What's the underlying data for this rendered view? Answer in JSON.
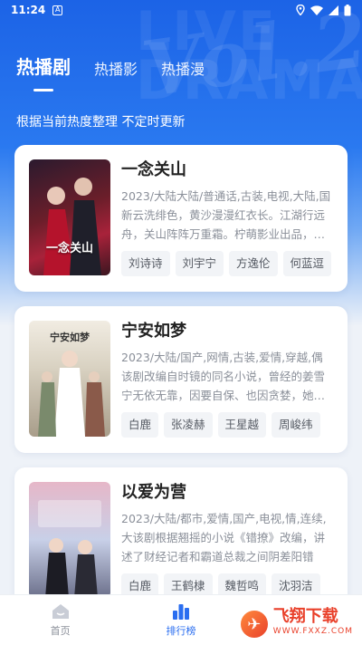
{
  "status_bar": {
    "time": "11:24",
    "notification_icon": "A"
  },
  "tabs": [
    {
      "label": "热播剧",
      "active": true
    },
    {
      "label": "热播影",
      "active": false
    },
    {
      "label": "热播漫",
      "active": false
    }
  ],
  "subtitle": "根据当前热度整理 不定时更新",
  "dramas": [
    {
      "title": "一念关山",
      "desc": "2023/大陆大陆/普通话,古装,电视,大陆,国新云洗绯色，黄沙漫漫红衣长。江湖行远舟，关山阵阵万重霜。柠萌影业出品，…",
      "actors": [
        "刘诗诗",
        "刘宇宁",
        "方逸伦",
        "何蓝逗"
      ],
      "poster_text": "一念关山"
    },
    {
      "title": "宁安如梦",
      "desc": "2023/大陆/国产,网情,古装,爱情,穿越,偶该剧改编自时镜的同名小说，曾经的姜雪宁无依无靠，因要自保、也因贪婪，她…",
      "actors": [
        "白鹿",
        "张凌赫",
        "王星越",
        "周峻纬"
      ],
      "poster_text": "宁安如梦"
    },
    {
      "title": "以爱为营",
      "desc": "2023/大陆/都市,爱情,国产,电视,情,连续,大该剧根据翘摇的小说《错撩》改编，讲述了财经记者和霸道总裁之间阴差阳错的…",
      "actors": [
        "白鹿",
        "王鹤棣",
        "魏哲鸣",
        "沈羽洁"
      ],
      "poster_text": ""
    }
  ],
  "bottom_nav": [
    {
      "label": "首页",
      "icon": "home-icon",
      "active": false
    },
    {
      "label": "排行榜",
      "icon": "ranking-icon",
      "active": true
    }
  ],
  "watermark": {
    "main": "飞翔下载",
    "sub": "WWW.FXXZ.COM"
  },
  "colors": {
    "accent": "#2a6ef0",
    "hero": "#1c63e6"
  }
}
